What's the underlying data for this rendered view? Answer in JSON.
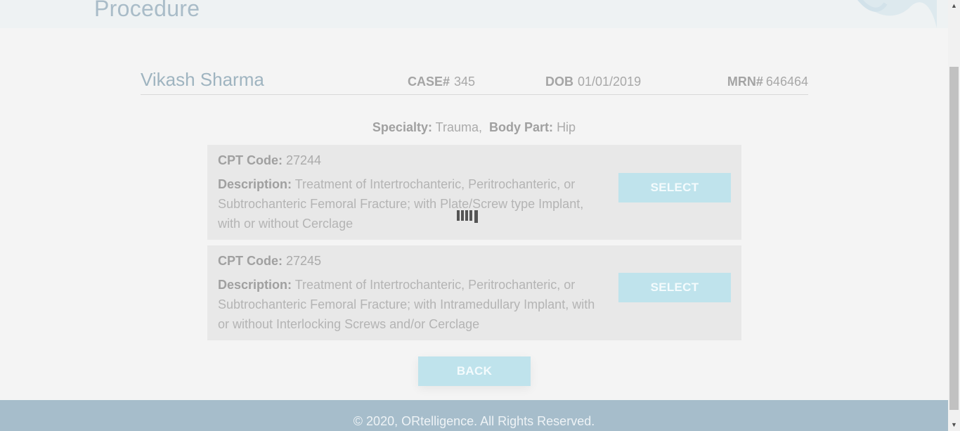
{
  "header": {
    "title": "Procedure"
  },
  "patient": {
    "name": "Vikash Sharma",
    "case_label": "CASE#",
    "case_value": "345",
    "dob_label": "DOB",
    "dob_value": "01/01/2019",
    "mrn_label": "MRN#",
    "mrn_value": "646464"
  },
  "filters": {
    "specialty_label": "Specialty:",
    "specialty_value": "Trauma,",
    "body_part_label": "Body Part:",
    "body_part_value": "Hip"
  },
  "procedures": [
    {
      "cpt_label": "CPT Code:",
      "cpt_value": "27244",
      "desc_label": "Description:",
      "desc_value": "Treatment of Intertrochanteric, Peritrochanteric, or Subtrochanteric Femoral Fracture; with Plate/Screw type Implant, with or without Cerclage",
      "button": "SELECT"
    },
    {
      "cpt_label": "CPT Code:",
      "cpt_value": "27245",
      "desc_label": "Description:",
      "desc_value": "Treatment of Intertrochanteric, Peritrochanteric, or Subtrochanteric Femoral Fracture; with Intramedullary Implant, with or without Interlocking Screws and/or Cerclage",
      "button": "SELECT"
    }
  ],
  "actions": {
    "back": "BACK"
  },
  "footer": {
    "copyright": "© 2020, ORtelligence. All Rights Reserved."
  },
  "icons": {
    "loading": "loading-spinner-icon",
    "scroll_up": "arrow-up-icon",
    "scroll_down": "arrow-down-icon"
  },
  "colors": {
    "accent_button": "#bfe3ec",
    "footer_bg": "#a6bdcb",
    "title_text": "#a9bcc8"
  }
}
